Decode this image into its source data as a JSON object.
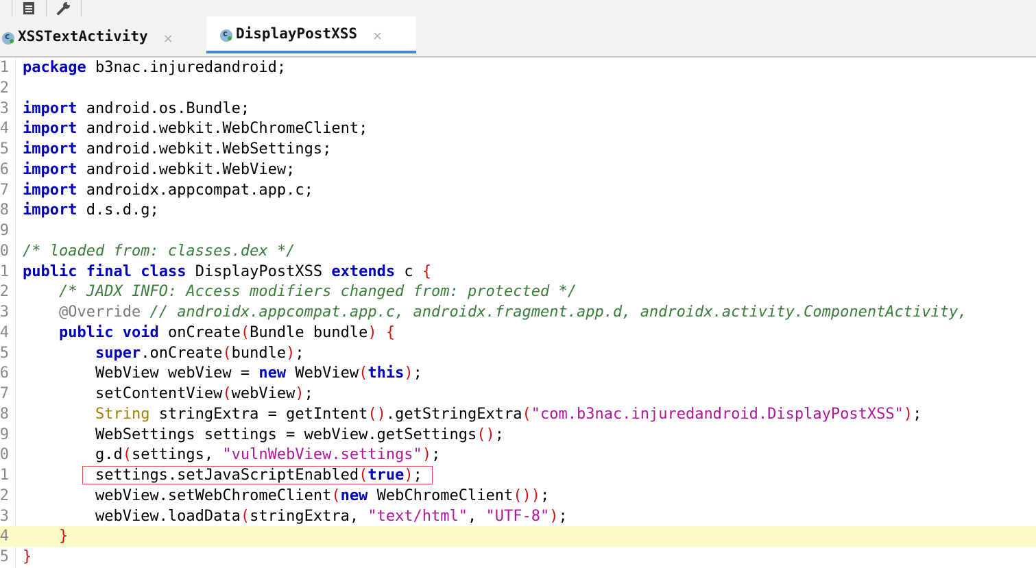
{
  "toolbar": {
    "icons": [
      "list-icon",
      "wrench-icon"
    ]
  },
  "tabs": [
    {
      "label": "XSSTextActivity",
      "active": false
    },
    {
      "label": "DisplayPostXSS",
      "active": true
    }
  ],
  "editor": {
    "current_line": 24,
    "highlighted_line": 21,
    "lines": [
      {
        "n": "1",
        "text": "package b3nac.injuredandroid;"
      },
      {
        "n": "2",
        "text": ""
      },
      {
        "n": "3",
        "text": "import android.os.Bundle;"
      },
      {
        "n": "4",
        "text": "import android.webkit.WebChromeClient;"
      },
      {
        "n": "5",
        "text": "import android.webkit.WebSettings;"
      },
      {
        "n": "6",
        "text": "import android.webkit.WebView;"
      },
      {
        "n": "7",
        "text": "import androidx.appcompat.app.c;"
      },
      {
        "n": "8",
        "text": "import d.s.d.g;"
      },
      {
        "n": "9",
        "text": ""
      },
      {
        "n": "0",
        "text": "/* loaded from: classes.dex */"
      },
      {
        "n": "1",
        "text": "public final class DisplayPostXSS extends c {"
      },
      {
        "n": "2",
        "text": "    /* JADX INFO: Access modifiers changed from: protected */"
      },
      {
        "n": "3",
        "text": "    @Override // androidx.appcompat.app.c, androidx.fragment.app.d, androidx.activity.ComponentActivity,"
      },
      {
        "n": "4",
        "text": "    public void onCreate(Bundle bundle) {"
      },
      {
        "n": "5",
        "text": "        super.onCreate(bundle);"
      },
      {
        "n": "6",
        "text": "        WebView webView = new WebView(this);"
      },
      {
        "n": "7",
        "text": "        setContentView(webView);"
      },
      {
        "n": "8",
        "text": "        String stringExtra = getIntent().getStringExtra(\"com.b3nac.injuredandroid.DisplayPostXSS\");"
      },
      {
        "n": "9",
        "text": "        WebSettings settings = webView.getSettings();"
      },
      {
        "n": "0",
        "text": "        g.d(settings, \"vulnWebView.settings\");"
      },
      {
        "n": "1",
        "text": "        settings.setJavaScriptEnabled(true);"
      },
      {
        "n": "2",
        "text": "        webView.setWebChromeClient(new WebChromeClient());"
      },
      {
        "n": "3",
        "text": "        webView.loadData(stringExtra, \"text/html\", \"UTF-8\");"
      },
      {
        "n": "4",
        "text": "    }"
      },
      {
        "n": "5",
        "text": "}"
      }
    ]
  }
}
